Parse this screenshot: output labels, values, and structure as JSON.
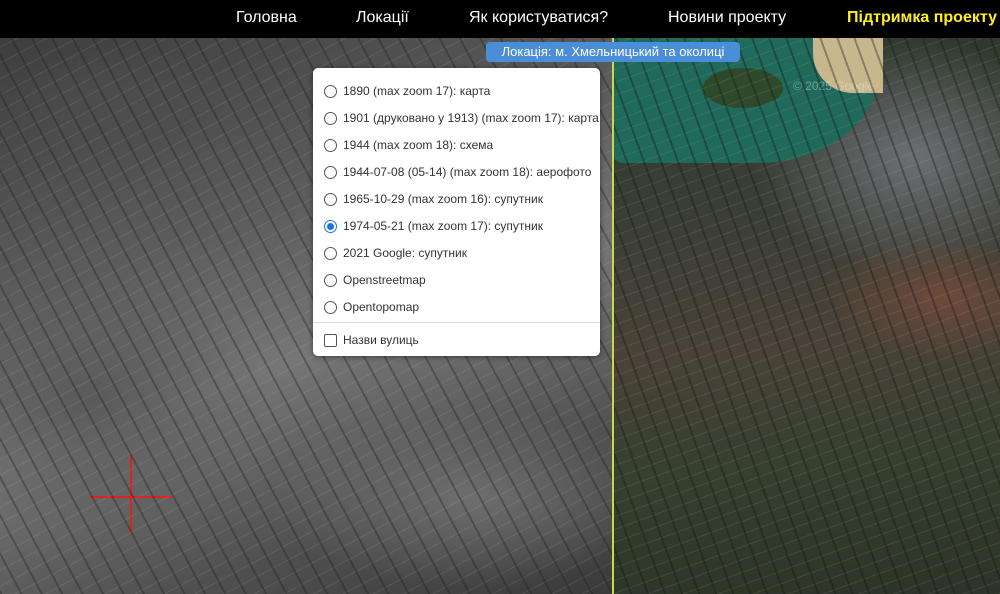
{
  "nav": {
    "items": [
      {
        "label": "Головна"
      },
      {
        "label": "Локації"
      },
      {
        "label": "Як користуватися?"
      },
      {
        "label": "Новини проекту"
      },
      {
        "label": "Підтримка проекту"
      }
    ]
  },
  "location_badge": "Локація: м. Хмельницький та околиці",
  "watermark": "© 2025 Google",
  "layers": {
    "options": [
      {
        "label": "1890 (max zoom 17): карта",
        "selected": false
      },
      {
        "label": "1901 (друковано у 1913) (max zoom 17): карта",
        "selected": false
      },
      {
        "label": "1944 (max zoom 18): схема",
        "selected": false
      },
      {
        "label": "1944-07-08 (05-14) (max zoom 18): аерофото",
        "selected": false
      },
      {
        "label": "1965-10-29 (max zoom 16): супутник",
        "selected": false
      },
      {
        "label": "1974-05-21 (max zoom 17): супутник",
        "selected": true
      },
      {
        "label": "2021 Google: супутник",
        "selected": false
      },
      {
        "label": "Openstreetmap",
        "selected": false
      },
      {
        "label": "Opentopomap",
        "selected": false
      }
    ],
    "overlay": {
      "label": "Назви вулиць",
      "checked": false
    }
  },
  "colors": {
    "accent_nav": "#ffef1c",
    "badge": "#4a8ed8",
    "radio_selected": "#1a73e8",
    "crosshair": "#dd2222",
    "divider": "#c8d84a"
  }
}
